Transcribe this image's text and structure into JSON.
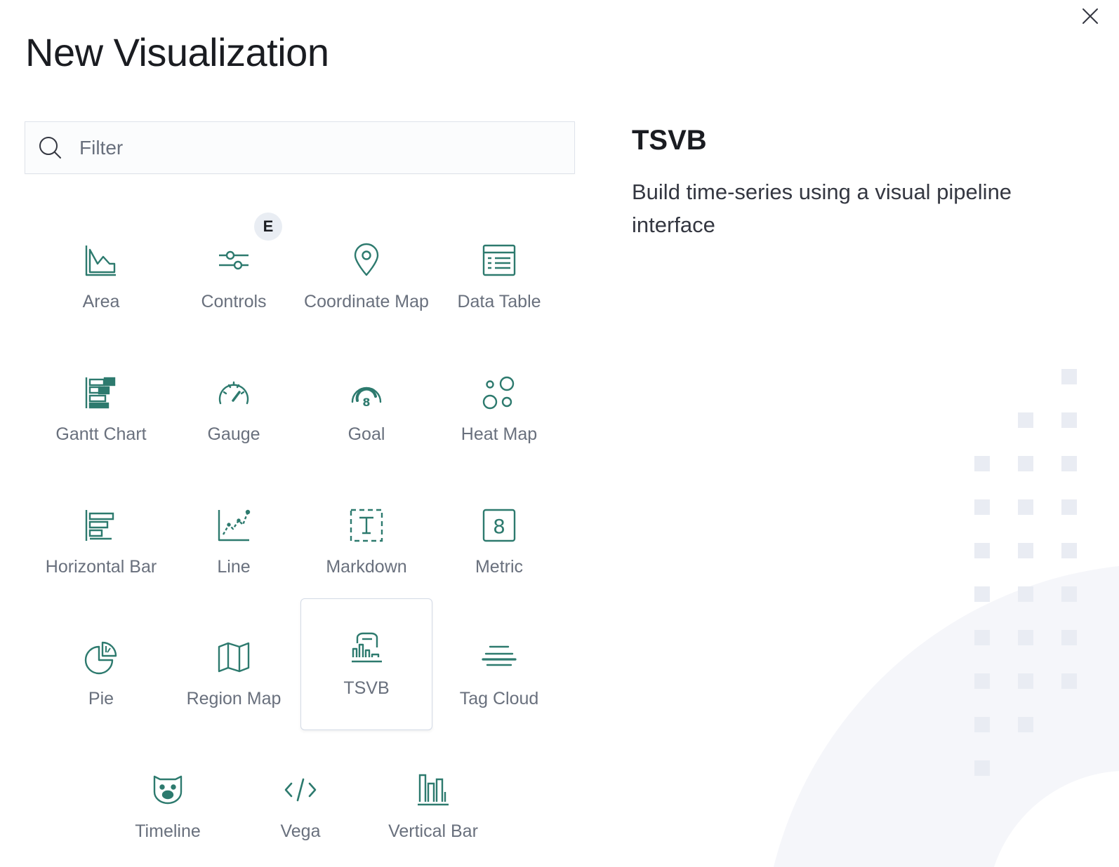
{
  "modal": {
    "title": "New Visualization",
    "close_label": "close"
  },
  "search": {
    "placeholder": "Filter",
    "value": ""
  },
  "types": [
    {
      "label": "Area",
      "icon": "area-chart-icon"
    },
    {
      "label": "Controls",
      "icon": "controls-icon",
      "badge": "E"
    },
    {
      "label": "Coordinate Map",
      "icon": "map-pin-icon"
    },
    {
      "label": "Data Table",
      "icon": "table-icon"
    },
    {
      "label": "Gantt Chart",
      "icon": "gantt-icon"
    },
    {
      "label": "Gauge",
      "icon": "gauge-icon"
    },
    {
      "label": "Goal",
      "icon": "goal-icon"
    },
    {
      "label": "Heat Map",
      "icon": "heat-map-icon"
    },
    {
      "label": "Horizontal Bar",
      "icon": "horizontal-bar-icon"
    },
    {
      "label": "Line",
      "icon": "line-chart-icon"
    },
    {
      "label": "Markdown",
      "icon": "markdown-icon"
    },
    {
      "label": "Metric",
      "icon": "metric-icon"
    },
    {
      "label": "Pie",
      "icon": "pie-chart-icon"
    },
    {
      "label": "Region Map",
      "icon": "region-map-icon"
    },
    {
      "label": "TSVB",
      "icon": "tsvb-icon",
      "selected": true
    },
    {
      "label": "Tag Cloud",
      "icon": "tag-cloud-icon"
    },
    {
      "label": "Timeline",
      "icon": "timeline-bear-icon"
    },
    {
      "label": "Vega",
      "icon": "code-icon"
    },
    {
      "label": "Vertical Bar",
      "icon": "vertical-bar-icon"
    }
  ],
  "detail": {
    "title": "TSVB",
    "description": "Build time-series using a visual pipeline interface"
  },
  "colors": {
    "icon_accent": "#2d7a6e",
    "label_text": "#69707d",
    "title_text": "#1a1c21",
    "decor": "#f0f2f7"
  }
}
